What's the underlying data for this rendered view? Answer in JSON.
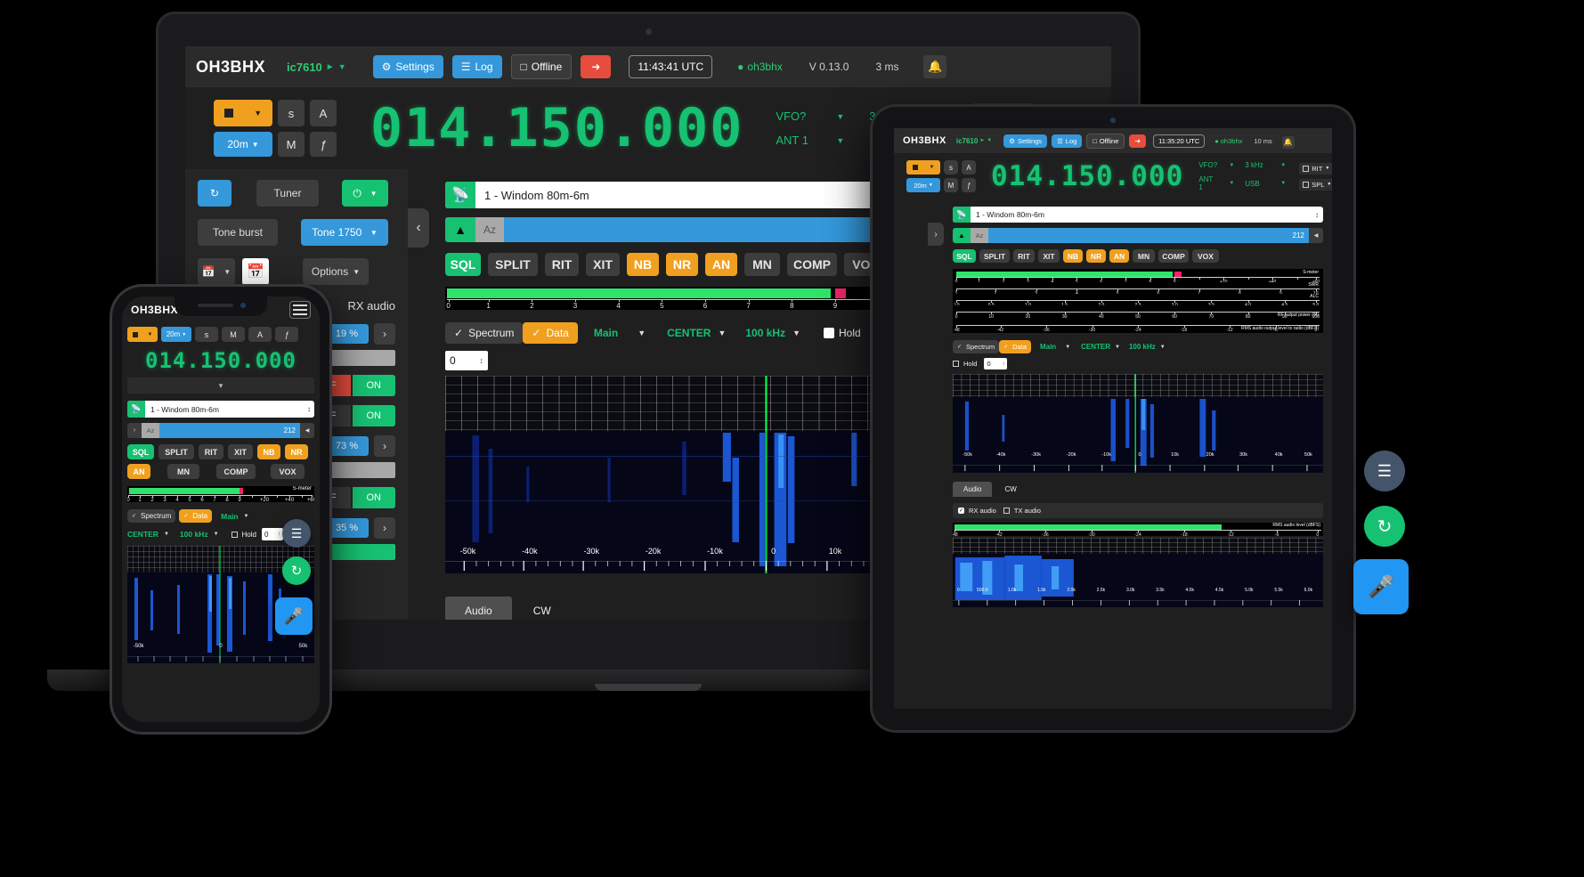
{
  "app": {
    "brand": "OH3BHX",
    "rig": "ic7610",
    "buttons": {
      "settings": "Settings",
      "log": "Log",
      "offline": "Offline",
      "logout": "logout-icon"
    },
    "clock_laptop": "11:43:41 UTC",
    "clock_tablet": "11:35:20 UTC",
    "user": "oh3bhx",
    "version": "V 0.13.0",
    "latency_laptop": "3 ms",
    "latency_tablet": "10 ms"
  },
  "vfo": {
    "frequency": "014.150.000",
    "vfo_label": "VFO?",
    "filter": "3 kHz",
    "ant": "ANT 1",
    "mode": "USB",
    "rit_label": "RIT",
    "spl_label": "SPL",
    "band": "20m",
    "keys": {
      "s": "s",
      "m": "M",
      "a": "A",
      "f": "ƒ"
    }
  },
  "sidepanel": {
    "refresh": "refresh-icon",
    "tuner": "Tuner",
    "power": "power-icon",
    "tone_burst": "Tone burst",
    "tone_1750": "Tone 1750",
    "calendar": "calendar-icon",
    "calendar_check": "calendar-check-icon",
    "options": "Options",
    "back": "Back",
    "rx_audio_label": "RX audio",
    "sliders": [
      {
        "value": "19 %",
        "state": ""
      },
      {
        "value": "",
        "state": ""
      },
      {
        "value": "",
        "off": "OFF",
        "on": "ON",
        "active": "on"
      },
      {
        "value": "",
        "off": "OFF",
        "on": "ON",
        "active": "on"
      },
      {
        "value": "73 %",
        "state": ""
      },
      {
        "value": "",
        "state": ""
      },
      {
        "value": "",
        "off": "OFF",
        "on": "ON",
        "active": "on"
      },
      {
        "value": "35 %",
        "state": ""
      }
    ]
  },
  "antenna": {
    "icon": "antenna-icon",
    "selected": "1 - Windom 80m-6m"
  },
  "rotator": {
    "up_icon": "north-arrow-icon",
    "label": "Az",
    "value": "212",
    "left_icon": "ccw-icon"
  },
  "modes": [
    {
      "label": "SQL",
      "state": "on-green"
    },
    {
      "label": "SPLIT",
      "state": ""
    },
    {
      "label": "RIT",
      "state": ""
    },
    {
      "label": "XIT",
      "state": ""
    },
    {
      "label": "NB",
      "state": "on-orange"
    },
    {
      "label": "NR",
      "state": "on-orange"
    },
    {
      "label": "AN",
      "state": "on-orange"
    },
    {
      "label": "MN",
      "state": ""
    },
    {
      "label": "COMP",
      "state": ""
    },
    {
      "label": "VOX",
      "state": ""
    }
  ],
  "smeter": {
    "name": "S-meter",
    "ticks": [
      "0",
      "1",
      "2",
      "3",
      "4",
      "5",
      "6",
      "7",
      "8",
      "9",
      "",
      "+20",
      "",
      "+40",
      "",
      "+60"
    ],
    "fill_pct": 61,
    "peak_pct": 61.5
  },
  "tablet_meters": [
    {
      "name": "S-meter",
      "ticks": [
        "0",
        "1",
        "2",
        "3",
        "4",
        "5",
        "6",
        "7",
        "8",
        "9",
        "",
        "+20",
        "",
        "+40",
        "",
        "+60"
      ],
      "fill_pct": 61
    },
    {
      "name": "SWR",
      "ticks": [
        "1",
        "2",
        "3",
        "4",
        "5",
        "6",
        "7",
        "8",
        "9",
        "10"
      ],
      "fill_pct": 0
    },
    {
      "name": "ALC",
      "ticks": [
        "0.0",
        "0.5",
        "1.0",
        "1.5",
        "2.0",
        "2.5",
        "3.0",
        "3.5",
        "4.0",
        "4.5",
        "5.0"
      ],
      "fill_pct": 0
    },
    {
      "name": "RF output power (%)",
      "ticks": [
        "0",
        "10",
        "20",
        "30",
        "40",
        "50",
        "60",
        "70",
        "80",
        "90",
        "100"
      ],
      "fill_pct": 0
    },
    {
      "name": "RMS audio output level to radio (dBFS)",
      "ticks": [
        "-48",
        "-42",
        "-36",
        "-30",
        "-24",
        "-18",
        "-12",
        "-6",
        "0"
      ],
      "fill_pct": 0
    }
  ],
  "spectrum": {
    "spectrum_label": "Spectrum",
    "data_label": "Data",
    "scope": "Main",
    "mode": "CENTER",
    "span": "100 kHz",
    "hold_label": "Hold",
    "offset_value": "0",
    "axis_labels": [
      "-50k",
      "-40k",
      "-30k",
      "-20k",
      "-10k",
      "0",
      "10k",
      "20k",
      "30k",
      "40k",
      "50k"
    ]
  },
  "audio_tabs": {
    "items": [
      "Audio",
      "CW"
    ],
    "active": "Audio"
  },
  "tablet_audio": {
    "rx_label": "RX audio",
    "tx_label": "TX audio",
    "meter_name": "RMS audio level (dBFS)",
    "meter_ticks": [
      "-48",
      "-42",
      "-36",
      "-30",
      "-24",
      "-18",
      "-12",
      "-6",
      "0"
    ],
    "meter_fill_pct": 72,
    "spectrum_axis": [
      "0",
      "500.0",
      "1.0k",
      "1.5k",
      "2.0k",
      "2.5k",
      "3.0k",
      "3.5k",
      "4.0k",
      "4.5k",
      "5.0k",
      "5.5k",
      "6.0k"
    ]
  },
  "phone": {
    "menu_icon": "hamburger-menu-icon",
    "chevron_icon": "chevron-down-icon",
    "waterfall_axis": [
      "-50k",
      "0",
      "50k"
    ]
  },
  "fabs": {
    "list": "list-icon",
    "refresh": "refresh-icon",
    "mic": "microphone-icon"
  },
  "colors": {
    "accent_blue": "#3498db",
    "accent_green": "#16c172",
    "accent_orange": "#f0a01e",
    "accent_red": "#e74c3c",
    "lcd_green": "#16c172",
    "meter_green": "#2fe36a",
    "meter_peak": "#f2226b",
    "bg_dark": "#1f1f1f",
    "bg_panel": "#2b2b2b"
  }
}
